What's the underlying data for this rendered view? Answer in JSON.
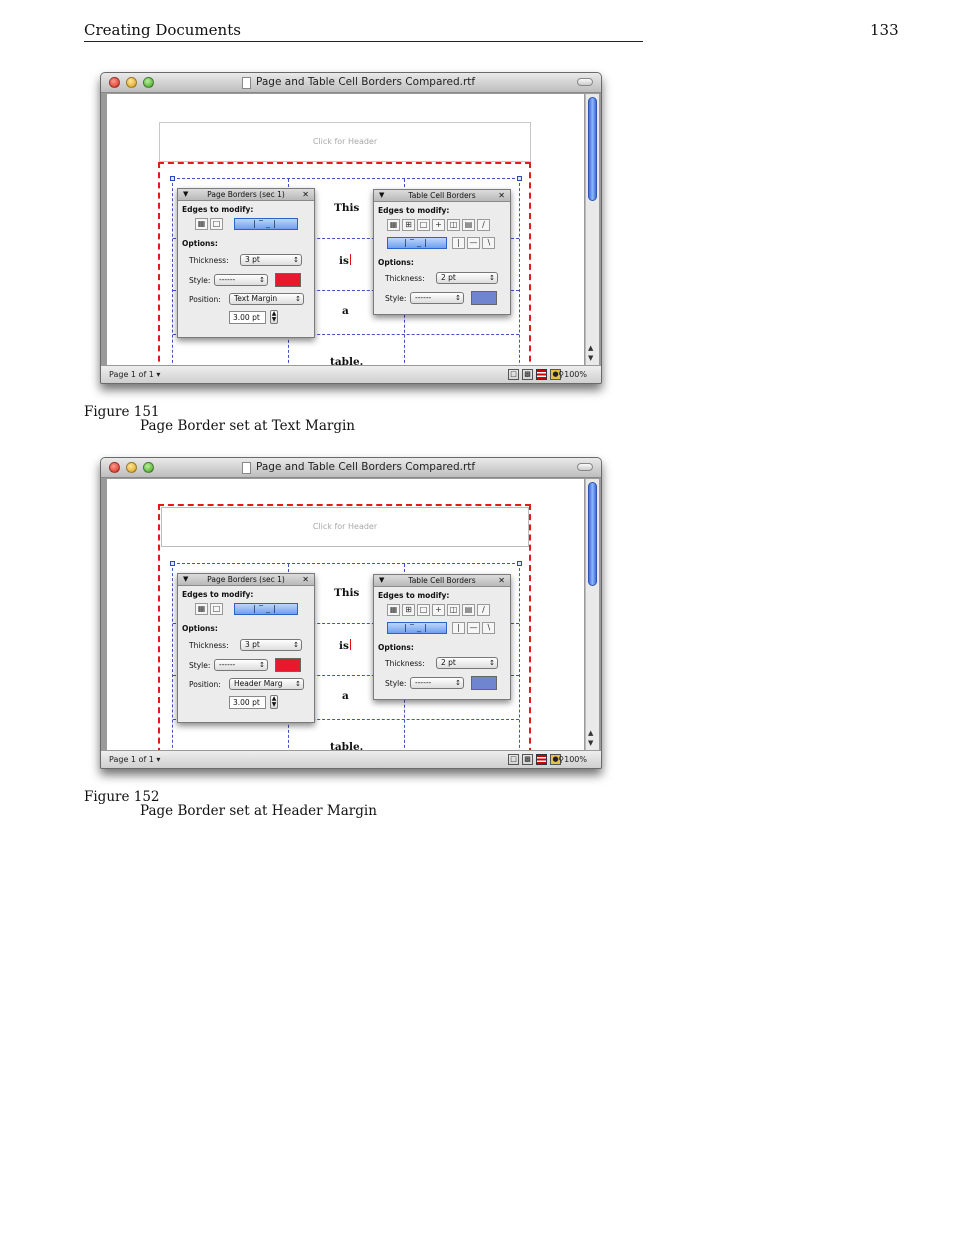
{
  "page": {
    "running_header": "Creating Documents",
    "page_number": "133"
  },
  "figures": [
    {
      "window_title": "Page and Table Cell Borders Compared.rtf",
      "header_placeholder": "Click for Header",
      "table_words": [
        "This",
        "is",
        "a",
        "table."
      ],
      "page_borders": {
        "title": "Page Borders (sec 1)",
        "edges_label": "Edges to modify:",
        "options_label": "Options:",
        "thickness_label": "Thickness:",
        "thickness_value": "3 pt",
        "style_label": "Style:",
        "style_value": "------",
        "color": "#e8192c",
        "position_label": "Position:",
        "position_value": "Text Margin",
        "offset_value": "3.00 pt"
      },
      "table_cell_borders": {
        "title": "Table Cell Borders",
        "edges_label": "Edges to modify:",
        "options_label": "Options:",
        "thickness_label": "Thickness:",
        "thickness_value": "2 pt",
        "style_label": "Style:",
        "style_value": "------",
        "color": "#7085d0"
      },
      "status": {
        "page_label": "Page 1 of 1 ▾",
        "zoom": "100%"
      },
      "figure_label": "Figure 151",
      "caption": "Page Border set at Text Margin"
    },
    {
      "window_title": "Page and Table Cell Borders Compared.rtf",
      "header_placeholder": "Click for Header",
      "table_words": [
        "This",
        "is",
        "a",
        "table."
      ],
      "page_borders": {
        "title": "Page Borders (sec 1)",
        "edges_label": "Edges to modify:",
        "options_label": "Options:",
        "thickness_label": "Thickness:",
        "thickness_value": "3 pt",
        "style_label": "Style:",
        "style_value": "------",
        "color": "#e8192c",
        "position_label": "Position:",
        "position_value": "Header Marg",
        "offset_value": "3.00 pt"
      },
      "table_cell_borders": {
        "title": "Table Cell Borders",
        "edges_label": "Edges to modify:",
        "options_label": "Options:",
        "thickness_label": "Thickness:",
        "thickness_value": "2 pt",
        "style_label": "Style:",
        "style_value": "------",
        "color": "#7085d0"
      },
      "status": {
        "page_label": "Page 1 of 1 ▾",
        "zoom": "100%"
      },
      "figure_label": "Figure 152",
      "caption": "Page Border set at Header Margin"
    }
  ]
}
